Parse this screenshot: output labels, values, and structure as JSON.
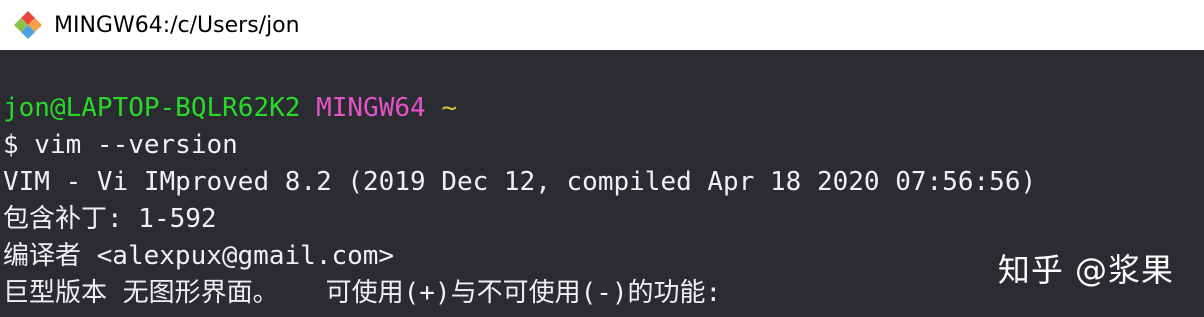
{
  "window": {
    "title": "MINGW64:/c/Users/jon",
    "icon": "git-bash-diamond-icon",
    "colors": {
      "background": "#2b2b32",
      "text": "#f0f0f0",
      "user_host": "#28d928",
      "system": "#e553c9",
      "path": "#d6c13f"
    }
  },
  "terminal": {
    "prompt": {
      "user_host": "jon@LAPTOP-BQLR62K2",
      "system": "MINGW64",
      "path": "~"
    },
    "command": "$ vim --version",
    "output": [
      "VIM - Vi IMproved 8.2 (2019 Dec 12, compiled Apr 18 2020 07:56:56)",
      "包含补丁: 1-592",
      "编译者 <alexpux@gmail.com>",
      "巨型版本 无图形界面。   可使用(+)与不可使用(-)的功能:"
    ]
  },
  "watermark": {
    "text": "知乎 @浆果"
  }
}
